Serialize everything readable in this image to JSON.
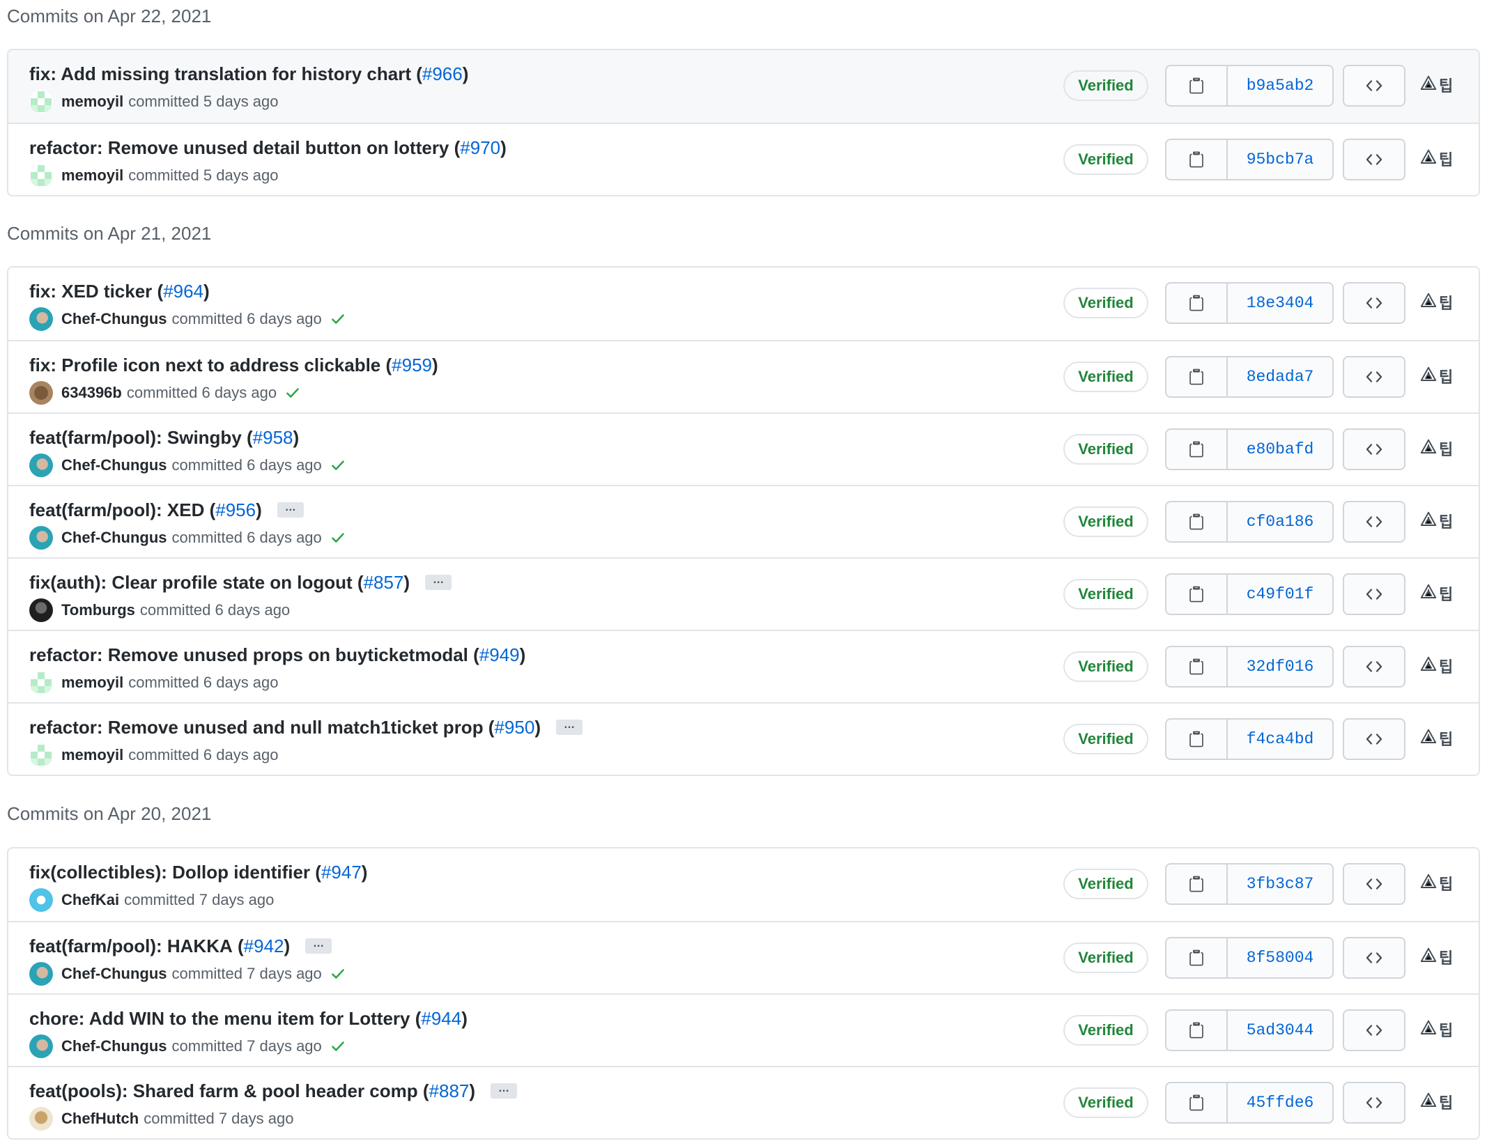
{
  "groups": [
    {
      "header": "Commits on Apr 22, 2021",
      "commits": [
        {
          "title": "fix: Add missing translation for history chart",
          "pr": "#966",
          "author": "memoyil",
          "verb": "committed",
          "time": "5 days ago",
          "sha": "b9a5ab2",
          "verified": "Verified",
          "check": false,
          "ellipsis": false,
          "avatar": "memoyil"
        },
        {
          "title": "refactor: Remove unused detail button on lottery",
          "pr": "#970",
          "author": "memoyil",
          "verb": "committed",
          "time": "5 days ago",
          "sha": "95bcb7a",
          "verified": "Verified",
          "check": false,
          "ellipsis": false,
          "avatar": "memoyil"
        }
      ]
    },
    {
      "header": "Commits on Apr 21, 2021",
      "commits": [
        {
          "title": "fix: XED ticker",
          "pr": "#964",
          "author": "Chef-Chungus",
          "verb": "committed",
          "time": "6 days ago",
          "sha": "18e3404",
          "verified": "Verified",
          "check": true,
          "ellipsis": false,
          "avatar": "chef"
        },
        {
          "title": "fix: Profile icon next to address clickable",
          "pr": "#959",
          "author": "634396b",
          "verb": "committed",
          "time": "6 days ago",
          "sha": "8edada7",
          "verified": "Verified",
          "check": true,
          "ellipsis": false,
          "avatar": "634"
        },
        {
          "title": "feat(farm/pool): Swingby",
          "pr": "#958",
          "author": "Chef-Chungus",
          "verb": "committed",
          "time": "6 days ago",
          "sha": "e80bafd",
          "verified": "Verified",
          "check": true,
          "ellipsis": false,
          "avatar": "chef"
        },
        {
          "title": "feat(farm/pool): XED",
          "pr": "#956",
          "author": "Chef-Chungus",
          "verb": "committed",
          "time": "6 days ago",
          "sha": "cf0a186",
          "verified": "Verified",
          "check": true,
          "ellipsis": true,
          "avatar": "chef"
        },
        {
          "title": "fix(auth): Clear profile state on logout",
          "pr": "#857",
          "author": "Tomburgs",
          "verb": "committed",
          "time": "6 days ago",
          "sha": "c49f01f",
          "verified": "Verified",
          "check": false,
          "ellipsis": true,
          "avatar": "tom"
        },
        {
          "title": "refactor: Remove unused props on buyticketmodal",
          "pr": "#949",
          "author": "memoyil",
          "verb": "committed",
          "time": "6 days ago",
          "sha": "32df016",
          "verified": "Verified",
          "check": false,
          "ellipsis": false,
          "avatar": "memoyil"
        },
        {
          "title": "refactor: Remove unused and null match1ticket prop",
          "pr": "#950",
          "author": "memoyil",
          "verb": "committed",
          "time": "6 days ago",
          "sha": "f4ca4bd",
          "verified": "Verified",
          "check": false,
          "ellipsis": true,
          "avatar": "memoyil"
        }
      ]
    },
    {
      "header": "Commits on Apr 20, 2021",
      "commits": [
        {
          "title": "fix(collectibles): Dollop identifier",
          "pr": "#947",
          "author": "ChefKai",
          "verb": "committed",
          "time": "7 days ago",
          "sha": "3fb3c87",
          "verified": "Verified",
          "check": false,
          "ellipsis": false,
          "avatar": "kai"
        },
        {
          "title": "feat(farm/pool): HAKKA",
          "pr": "#942",
          "author": "Chef-Chungus",
          "verb": "committed",
          "time": "7 days ago",
          "sha": "8f58004",
          "verified": "Verified",
          "check": true,
          "ellipsis": true,
          "avatar": "chef"
        },
        {
          "title": "chore: Add WIN to the menu item for Lottery",
          "pr": "#944",
          "author": "Chef-Chungus",
          "verb": "committed",
          "time": "7 days ago",
          "sha": "5ad3044",
          "verified": "Verified",
          "check": true,
          "ellipsis": false,
          "avatar": "chef"
        },
        {
          "title": "feat(pools): Shared farm & pool header comp",
          "pr": "#887",
          "author": "ChefHutch",
          "verb": "committed",
          "time": "7 days ago",
          "sha": "45ffde6",
          "verified": "Verified",
          "check": false,
          "ellipsis": true,
          "avatar": "hutch"
        }
      ]
    }
  ],
  "ui": {
    "ellipsis_label": "…",
    "ext_label": "팁",
    "colors": {
      "link": "#0366d6",
      "verified": "#22863a",
      "border": "#e1e4e8"
    },
    "icons": [
      "clipboard-icon",
      "code-icon",
      "alert-triangle-icon",
      "check-icon"
    ]
  }
}
